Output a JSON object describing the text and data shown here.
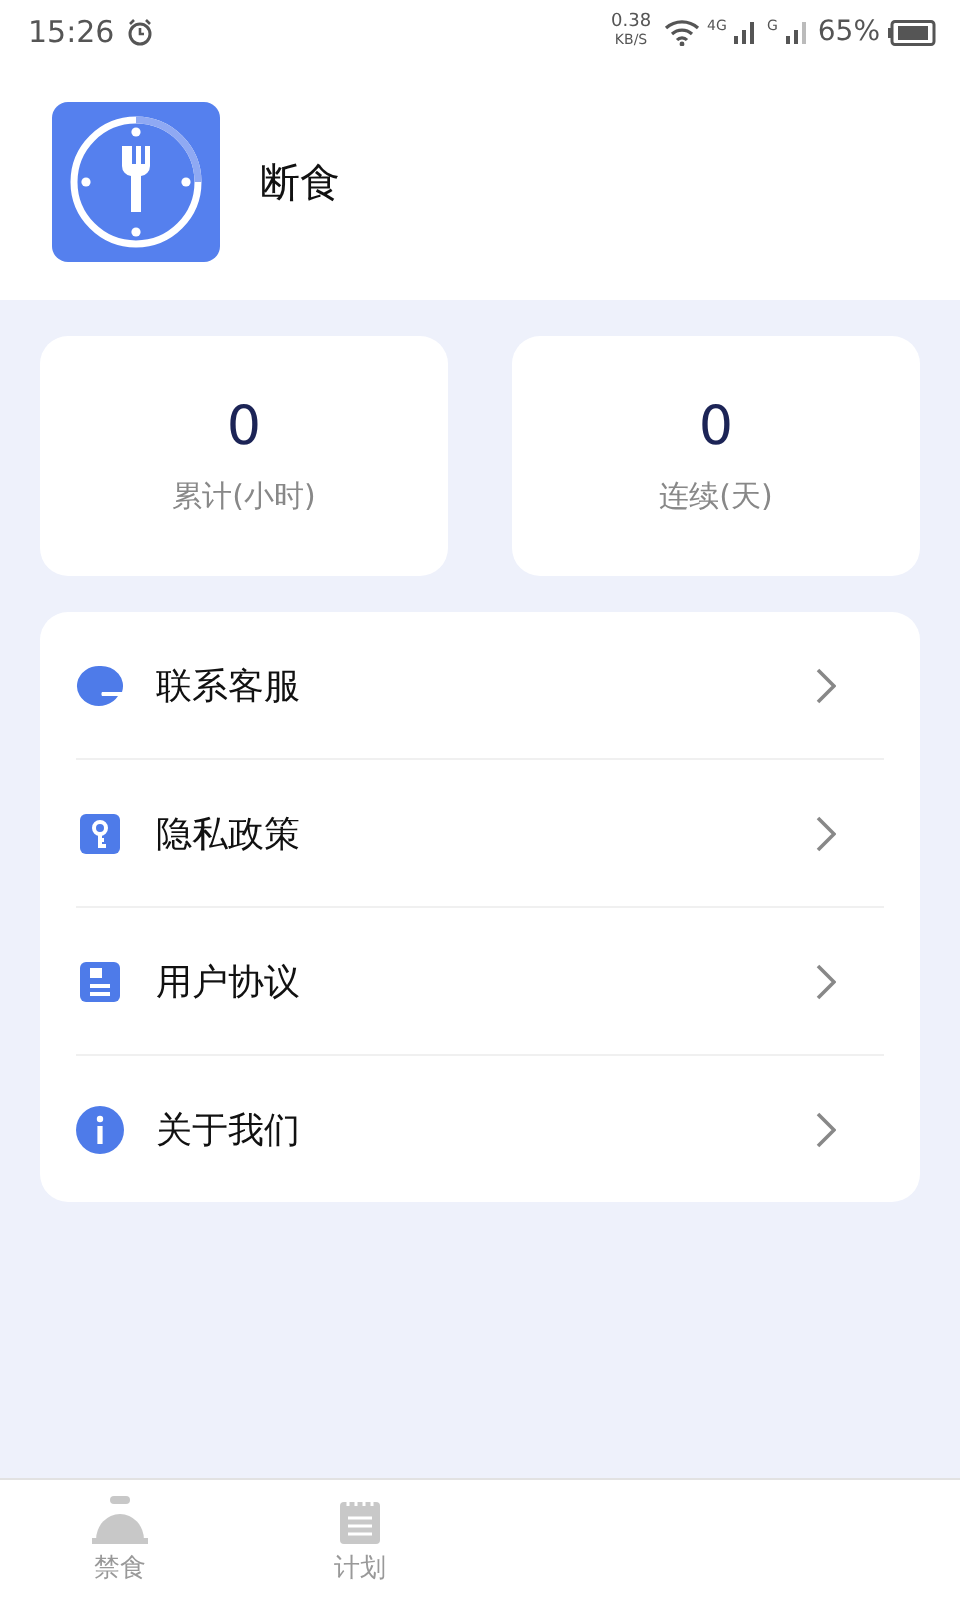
{
  "status_bar": {
    "time": "15:26",
    "speed_value": "0.38",
    "speed_unit": "KB/S",
    "network_1": "4G",
    "network_2": "G",
    "battery": "65%"
  },
  "header": {
    "title": "断食"
  },
  "stats": [
    {
      "value": "0",
      "label": "累计(小时)"
    },
    {
      "value": "0",
      "label": "连续(天)"
    }
  ],
  "menu": [
    {
      "kind": "service",
      "label": "联系客服"
    },
    {
      "kind": "privacy",
      "label": "隐私政策"
    },
    {
      "kind": "agreement",
      "label": "用户协议"
    },
    {
      "kind": "about",
      "label": "关于我们"
    }
  ],
  "tabs": [
    {
      "kind": "fast",
      "label": "禁食",
      "selected": false
    },
    {
      "kind": "plan",
      "label": "计划",
      "selected": false
    }
  ]
}
